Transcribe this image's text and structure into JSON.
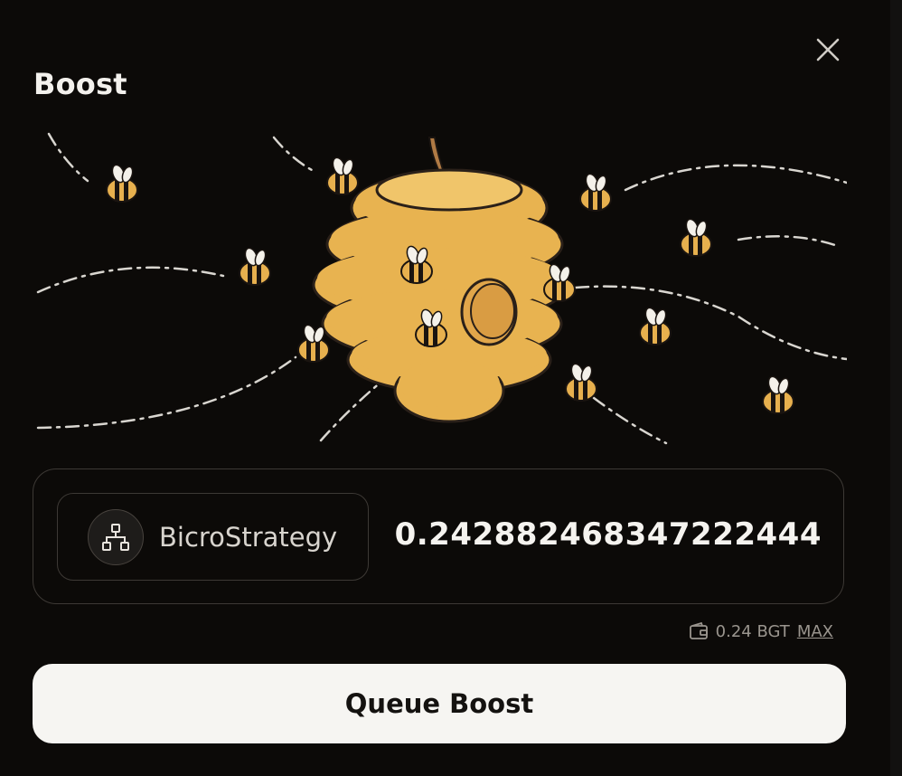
{
  "modal": {
    "title": "Boost",
    "close_icon": "close-icon",
    "illustration": "beehive-with-bees"
  },
  "input": {
    "vault_icon": "network-hierarchy-icon",
    "vault_name": "BicroStrategy",
    "amount": "0.242882468347222444"
  },
  "balance": {
    "icon": "wallet-icon",
    "text": "0.24 BGT",
    "max_label": "MAX"
  },
  "actions": {
    "queue_label": "Queue Boost"
  },
  "colors": {
    "background": "#0c0a08",
    "hive": "#e8b350",
    "button_bg": "#f6f5f2"
  }
}
